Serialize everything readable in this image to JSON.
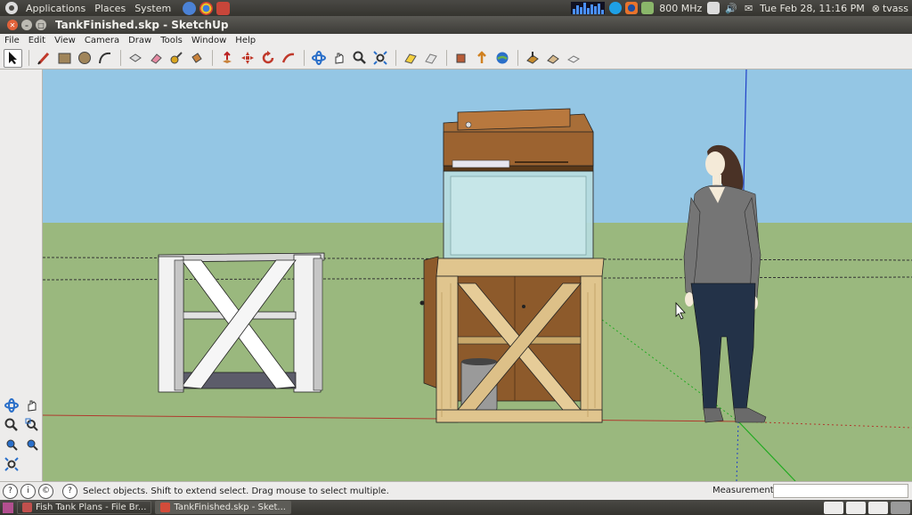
{
  "panel": {
    "menus": [
      "Applications",
      "Places",
      "System"
    ],
    "cpu_freq": "800 MHz",
    "datetime": "Tue Feb 28, 11:16 PM",
    "user": "tvass"
  },
  "window": {
    "title": "TankFinished.skp - SketchUp"
  },
  "menubar": [
    "File",
    "Edit",
    "View",
    "Camera",
    "Draw",
    "Tools",
    "Window",
    "Help"
  ],
  "toolbar": {
    "tools": [
      "select-arrow-icon",
      "pencil-line-icon",
      "rectangle-icon",
      "circle-icon",
      "arc-icon",
      "make-component-icon",
      "eraser-icon",
      "tape-measure-icon",
      "paint-bucket-icon",
      "push-pull-icon",
      "move-icon",
      "rotate-icon",
      "follow-me-icon",
      "orbit-icon",
      "pan-icon",
      "zoom-icon",
      "zoom-extents-icon",
      "previous-view-icon",
      "next-view-icon",
      "get-models-icon",
      "share-model-icon",
      "google-earth-icon",
      "get-current-view-icon",
      "toggle-terrain-icon",
      "place-model-icon"
    ]
  },
  "left_tools": [
    "orbit-icon",
    "pan-icon",
    "zoom-icon",
    "zoom-window-icon",
    "previous-view-icon",
    "next-view-icon",
    "zoom-extents-icon"
  ],
  "status": {
    "message": "Select objects. Shift to extend select. Drag mouse to select multiple.",
    "measurements_label": "Measurements"
  },
  "taskbar": {
    "tasks": [
      "Fish Tank Plans - File Br...",
      "TankFinished.skp - Sket..."
    ]
  },
  "colors": {
    "sky": "#94c6e4",
    "ground": "#9ab87e",
    "wood_light": "#e0c58e",
    "wood_dark": "#8d5a2b"
  }
}
